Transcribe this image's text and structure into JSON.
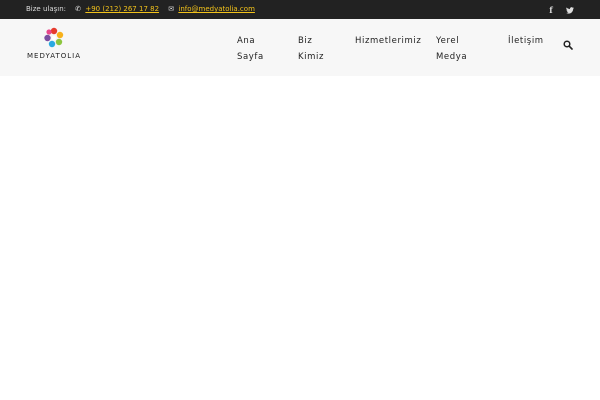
{
  "topbar": {
    "contact_label": "Bize ulaşın:",
    "phone": "+90 (212) 267 17 82",
    "email": "info@medyatolia.com",
    "social": [
      {
        "icon": "facebook-icon",
        "glyph": "f"
      },
      {
        "icon": "twitter-icon",
        "glyph": "t"
      }
    ]
  },
  "logo": {
    "text": "MEDYATOLIA",
    "colors": [
      "#e63b2e",
      "#f7b11b",
      "#8cc63e",
      "#2aa9e0",
      "#7b4fa0",
      "#e8478b"
    ]
  },
  "nav": {
    "items": [
      {
        "line1": "Ana",
        "line2": "Sayfa"
      },
      {
        "line1": "Biz",
        "line2": "Kimiz"
      },
      {
        "line1": "Hizmetlerimiz",
        "line2": ""
      },
      {
        "line1": "Yerel",
        "line2": "Medya"
      },
      {
        "line1": "İletişim",
        "line2": ""
      }
    ],
    "search_icon": "search-icon"
  },
  "colors": {
    "topbar_bg": "#222222",
    "header_bg": "#f7f7f7",
    "link": "#f2c21b"
  }
}
